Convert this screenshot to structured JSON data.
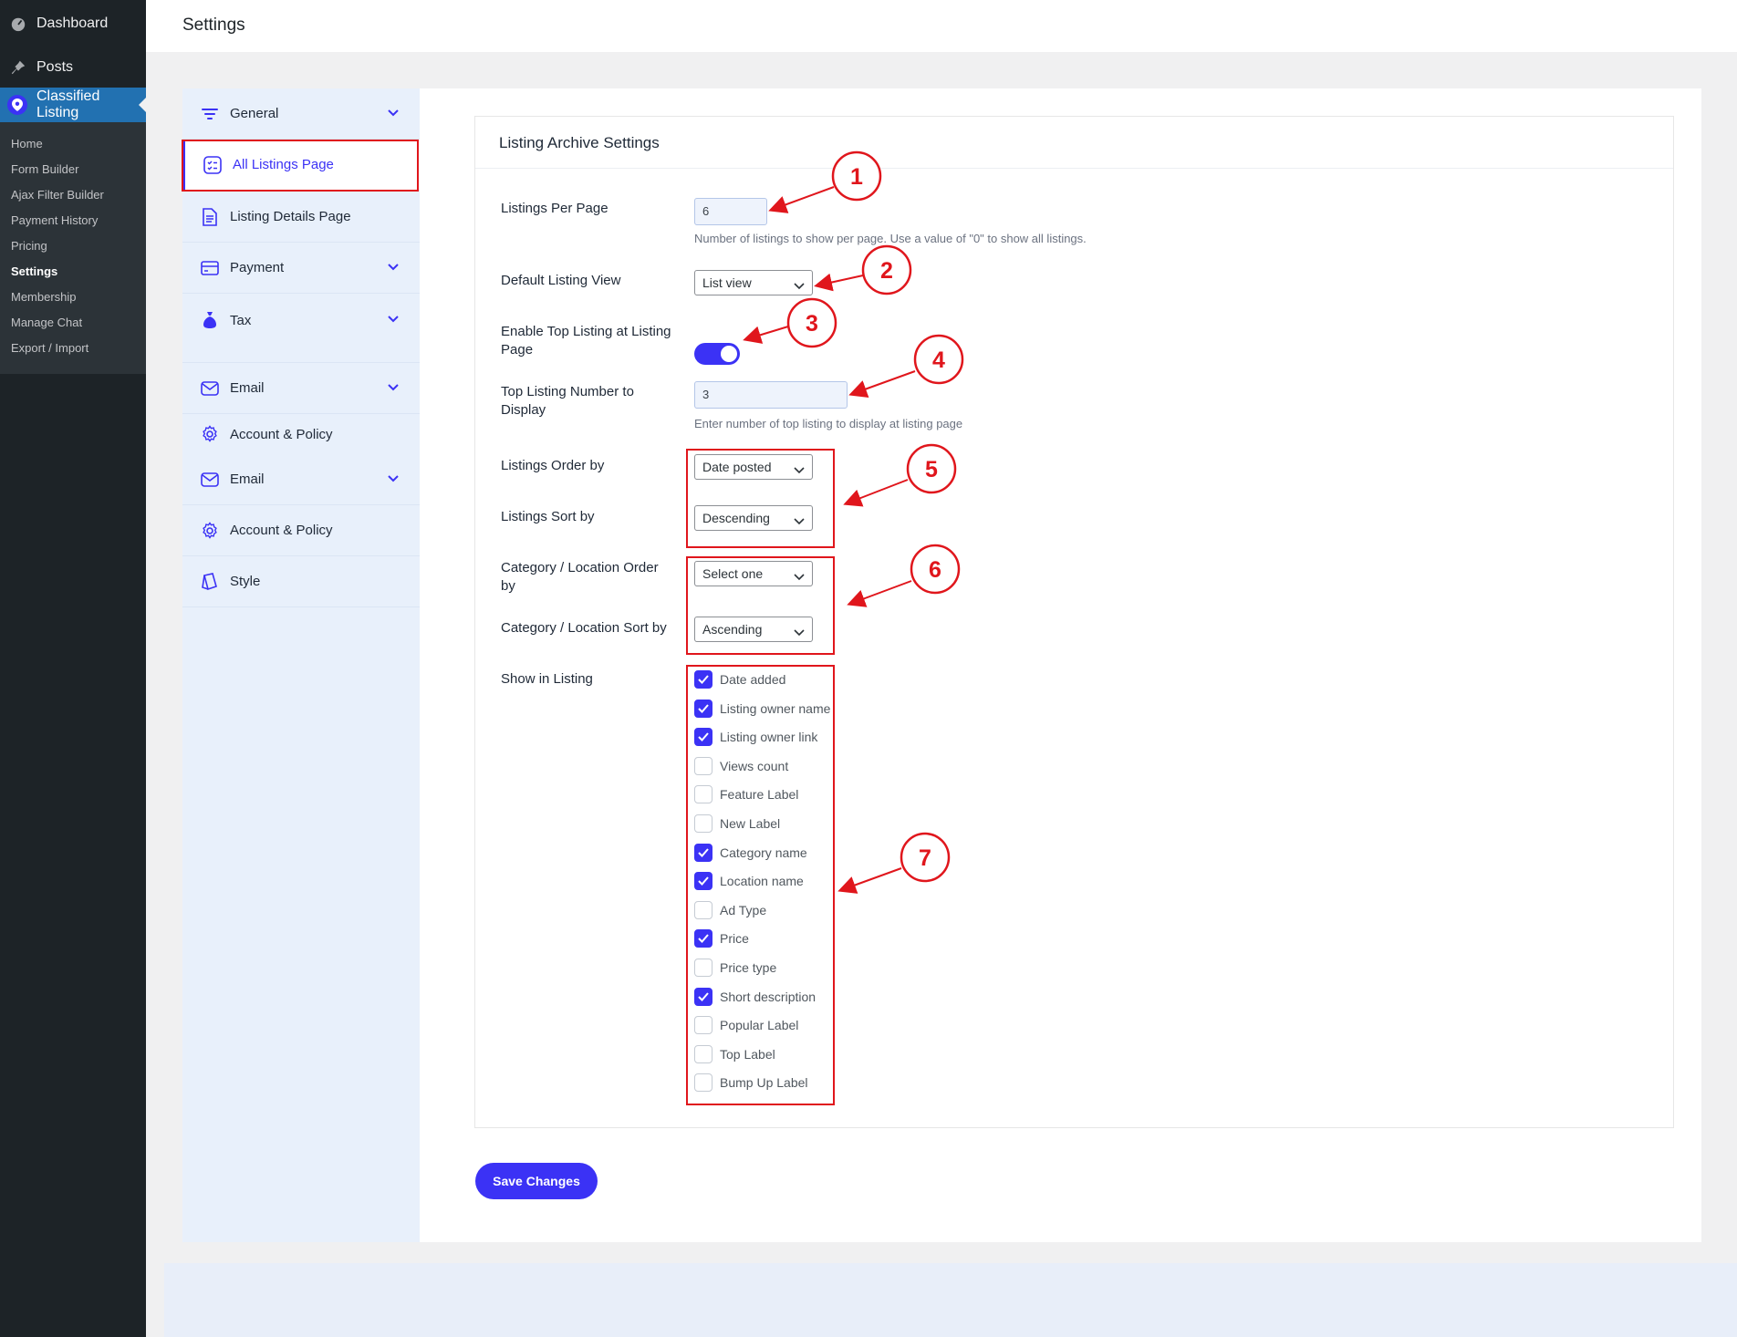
{
  "wp_menu": {
    "dashboard": "Dashboard",
    "posts": "Posts",
    "plugin": "Classified Listing",
    "submenu": [
      {
        "label": "Home"
      },
      {
        "label": "Form Builder"
      },
      {
        "label": "Ajax Filter Builder"
      },
      {
        "label": "Payment History"
      },
      {
        "label": "Pricing"
      },
      {
        "label": "Settings"
      },
      {
        "label": "Membership"
      },
      {
        "label": "Manage Chat"
      },
      {
        "label": "Export / Import"
      }
    ]
  },
  "page": {
    "title": "Settings"
  },
  "settings_menu": [
    {
      "label": "General",
      "icon": "filter-lines-icon",
      "expand": true
    },
    {
      "label": "All Listings Page",
      "icon": "checklist-icon",
      "expand": false,
      "active": true
    },
    {
      "label": "Listing Details Page",
      "icon": "document-icon",
      "expand": false
    },
    {
      "label": "Payment",
      "icon": "credit-card-icon",
      "expand": true
    },
    {
      "label": "Tax",
      "icon": "money-bag-icon",
      "expand": true
    },
    {
      "label": "Email",
      "icon": "envelope-icon",
      "expand": true
    },
    {
      "label": "Account & Policy",
      "icon": "gear-icon",
      "expand": false
    },
    {
      "label": "Email",
      "icon": "envelope-icon",
      "expand": true
    },
    {
      "label": "Account & Policy",
      "icon": "gear-icon",
      "expand": false
    },
    {
      "label": "Style",
      "icon": "paint-icon",
      "expand": false
    }
  ],
  "card": {
    "title": "Listing Archive Settings",
    "listings_per_page": {
      "label": "Listings Per Page",
      "value": "6",
      "help": "Number of listings to show per page. Use a value of \"0\" to show all listings."
    },
    "default_view": {
      "label": "Default Listing View",
      "value": "List view"
    },
    "top_listing": {
      "label": "Enable Top Listing at Listing Page",
      "enabled": true
    },
    "top_number": {
      "label": "Top Listing Number to Display",
      "value": "3",
      "help": "Enter number of top listing to display at listing page"
    },
    "order_by": {
      "label": "Listings Order by",
      "value": "Date posted"
    },
    "sort_by": {
      "label": "Listings Sort by",
      "value": "Descending"
    },
    "cat_order": {
      "label": "Category / Location Order by",
      "value": "Select one"
    },
    "cat_sort": {
      "label": "Category / Location Sort by",
      "value": "Ascending"
    },
    "show_in_listing": {
      "label": "Show in Listing",
      "options": [
        {
          "label": "Date added",
          "checked": true
        },
        {
          "label": "Listing owner name",
          "checked": true
        },
        {
          "label": "Listing owner link",
          "checked": true
        },
        {
          "label": "Views count",
          "checked": false
        },
        {
          "label": "Feature Label",
          "checked": false
        },
        {
          "label": "New Label",
          "checked": false
        },
        {
          "label": "Category name",
          "checked": true
        },
        {
          "label": "Location name",
          "checked": true
        },
        {
          "label": "Ad Type",
          "checked": false
        },
        {
          "label": "Price",
          "checked": true
        },
        {
          "label": "Price type",
          "checked": false
        },
        {
          "label": "Short description",
          "checked": true
        },
        {
          "label": "Popular Label",
          "checked": false
        },
        {
          "label": "Top Label",
          "checked": false
        },
        {
          "label": "Bump Up Label",
          "checked": false
        }
      ]
    }
  },
  "save_label": "Save Changes",
  "annotations": [
    "1",
    "2",
    "3",
    "4",
    "5",
    "6",
    "7"
  ],
  "colors": {
    "accent": "#3b32f5",
    "annotation": "#e0161c",
    "wp_sidebar": "#1d2327",
    "wp_active": "#2271b1"
  }
}
